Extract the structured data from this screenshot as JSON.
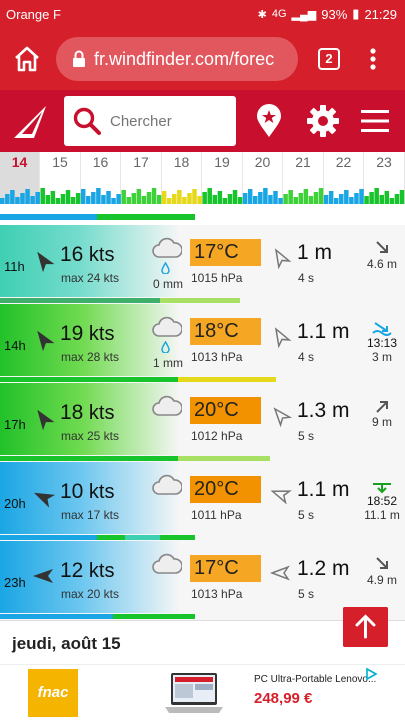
{
  "status": {
    "carrier": "Orange F",
    "network": "4G",
    "battery": "93%",
    "time": "21:29"
  },
  "browser": {
    "url": "fr.windfinder.com/forec",
    "tab_count": "2"
  },
  "header": {
    "search_placeholder": "Chercher"
  },
  "days": [
    {
      "label": "14",
      "active": true
    },
    {
      "label": "15"
    },
    {
      "label": "16"
    },
    {
      "label": "17"
    },
    {
      "label": "18"
    },
    {
      "label": "19"
    },
    {
      "label": "20"
    },
    {
      "label": "21"
    },
    {
      "label": "22"
    },
    {
      "label": "23"
    }
  ],
  "forecast": [
    {
      "hour": "11h",
      "speed": "16",
      "unit": "kts",
      "gust": "max 24 kts",
      "rain": "0 mm",
      "temp": "17°C",
      "pressure": "1015 hPa",
      "wave": "1 m",
      "period": "4 s",
      "tide_time": "",
      "tide_value": "4.6 m",
      "temp_color": "#f5a623"
    },
    {
      "hour": "14h",
      "speed": "19",
      "unit": "kts",
      "gust": "max 28 kts",
      "rain": "1 mm",
      "temp": "18°C",
      "pressure": "1013 hPa",
      "wave": "1.1 m",
      "period": "4 s",
      "tide_time": "13:13",
      "tide_value": "3 m",
      "temp_color": "#f5a623"
    },
    {
      "hour": "17h",
      "speed": "18",
      "unit": "kts",
      "gust": "max 25 kts",
      "rain": "",
      "temp": "20°C",
      "pressure": "1012 hPa",
      "wave": "1.3 m",
      "period": "5 s",
      "tide_time": "",
      "tide_value": "9 m",
      "temp_color": "#f39200"
    },
    {
      "hour": "20h",
      "speed": "10",
      "unit": "kts",
      "gust": "max 17 kts",
      "rain": "",
      "temp": "20°C",
      "pressure": "1011 hPa",
      "wave": "1.1 m",
      "period": "5 s",
      "tide_time": "18:52",
      "tide_value": "11.1 m",
      "temp_color": "#f39200"
    },
    {
      "hour": "23h",
      "speed": "12",
      "unit": "kts",
      "gust": "max 20 kts",
      "rain": "",
      "temp": "17°C",
      "pressure": "1013 hPa",
      "wave": "1.2 m",
      "period": "5 s",
      "tide_time": "",
      "tide_value": "4.9 m",
      "temp_color": "#f5a623"
    }
  ],
  "next_day": "jeudi, août 15",
  "ad": {
    "brand": "fnac",
    "product": "PC Ultra-Portable Lenovo...",
    "price": "248,99 €"
  }
}
